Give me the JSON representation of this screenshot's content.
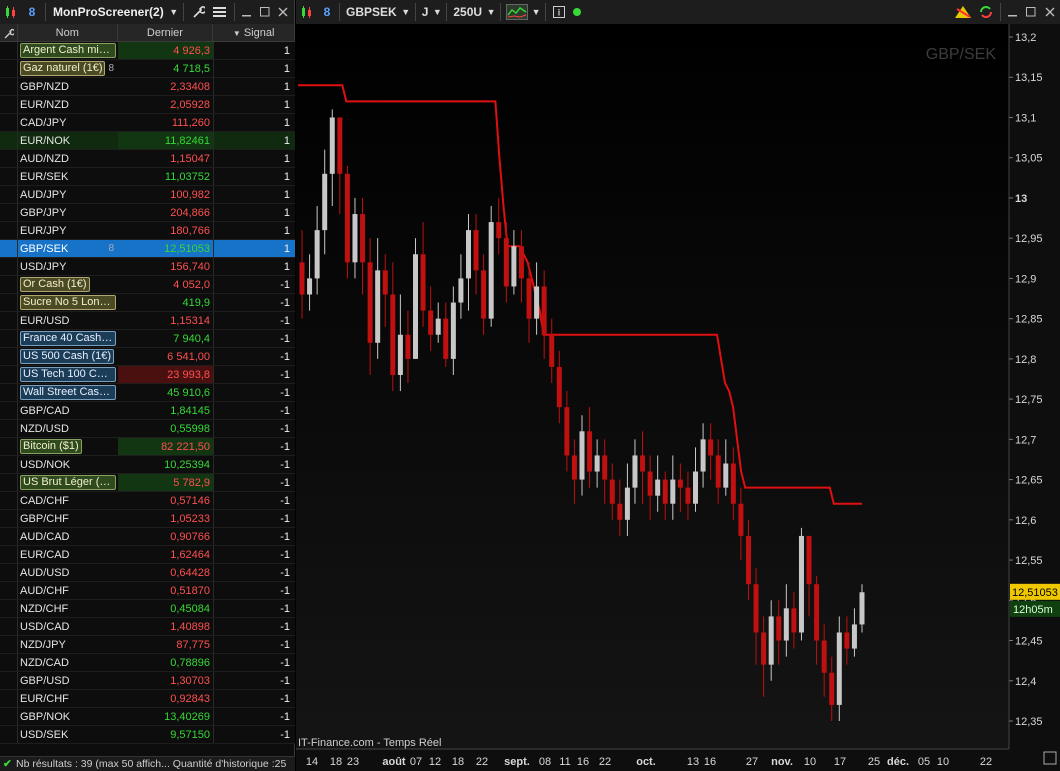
{
  "screener": {
    "title": "MonProScreener(2)",
    "columns": {
      "name": "Nom",
      "last": "Dernier",
      "signal": "Signal"
    },
    "rows": [
      {
        "name": "Argent Cash mini ...",
        "last": "4 926,3",
        "signal": "1",
        "style": "chip-green",
        "color": "#ff5050"
      },
      {
        "name": "Gaz naturel (1€)",
        "last": "4 718,5",
        "signal": "1",
        "style": "chip-olive",
        "color": "#36d936"
      },
      {
        "name": "GBP/NZD",
        "last": "2,33408",
        "signal": "1",
        "style": "",
        "color": "#ff5050"
      },
      {
        "name": "EUR/NZD",
        "last": "2,05928",
        "signal": "1",
        "style": "",
        "color": "#ff5050"
      },
      {
        "name": "CAD/JPY",
        "last": "111,260",
        "signal": "1",
        "style": "",
        "color": "#ff5050"
      },
      {
        "name": "EUR/NOK",
        "last": "11,82461",
        "signal": "1",
        "style": "green",
        "color": "#36d936"
      },
      {
        "name": "AUD/NZD",
        "last": "1,15047",
        "signal": "1",
        "style": "",
        "color": "#ff5050"
      },
      {
        "name": "EUR/SEK",
        "last": "11,03752",
        "signal": "1",
        "style": "",
        "color": "#36d936"
      },
      {
        "name": "AUD/JPY",
        "last": "100,982",
        "signal": "1",
        "style": "",
        "color": "#ff5050"
      },
      {
        "name": "GBP/JPY",
        "last": "204,866",
        "signal": "1",
        "style": "",
        "color": "#ff5050"
      },
      {
        "name": "EUR/JPY",
        "last": "180,766",
        "signal": "1",
        "style": "",
        "color": "#ff5050"
      },
      {
        "name": "GBP/SEK",
        "last": "12,51053",
        "signal": "1",
        "style": "sel",
        "color": "#36d936"
      },
      {
        "name": "USD/JPY",
        "last": "156,740",
        "signal": "1",
        "style": "",
        "color": "#ff5050"
      },
      {
        "name": "Or Cash (1€)",
        "last": "4 052,0",
        "signal": "-1",
        "style": "chip-olive",
        "color": "#ff5050"
      },
      {
        "name": "Sucre No 5 Londr...",
        "last": "419,9",
        "signal": "-1",
        "style": "chip-olive",
        "color": "#36d936"
      },
      {
        "name": "EUR/USD",
        "last": "1,15314",
        "signal": "-1",
        "style": "",
        "color": "#ff5050"
      },
      {
        "name": "France 40 Cash (...",
        "last": "7 940,4",
        "signal": "-1",
        "style": "chip-blue",
        "color": "#36d936"
      },
      {
        "name": "US 500 Cash (1€)",
        "last": "6 541,00",
        "signal": "-1",
        "style": "chip-blue",
        "color": "#ff5050"
      },
      {
        "name": "US Tech 100 Cas...",
        "last": "23 993,8",
        "signal": "-1",
        "style": "chip-blue-red",
        "color": "#ff5050"
      },
      {
        "name": "Wall Street Cash ...",
        "last": "45 910,6",
        "signal": "-1",
        "style": "chip-blue",
        "color": "#36d936"
      },
      {
        "name": "GBP/CAD",
        "last": "1,84145",
        "signal": "-1",
        "style": "",
        "color": "#36d936"
      },
      {
        "name": "NZD/USD",
        "last": "0,55998",
        "signal": "-1",
        "style": "",
        "color": "#36d936"
      },
      {
        "name": "Bitcoin ($1)",
        "last": "82 221,50",
        "signal": "-1",
        "style": "chip-green",
        "color": "#ff5050"
      },
      {
        "name": "USD/NOK",
        "last": "10,25394",
        "signal": "-1",
        "style": "",
        "color": "#36d936"
      },
      {
        "name": "US Brut Léger (1$)",
        "last": "5 782,9",
        "signal": "-1",
        "style": "chip-green",
        "color": "#ff5050"
      },
      {
        "name": "CAD/CHF",
        "last": "0,57146",
        "signal": "-1",
        "style": "",
        "color": "#ff5050"
      },
      {
        "name": "GBP/CHF",
        "last": "1,05233",
        "signal": "-1",
        "style": "",
        "color": "#ff5050"
      },
      {
        "name": "AUD/CAD",
        "last": "0,90766",
        "signal": "-1",
        "style": "",
        "color": "#ff5050"
      },
      {
        "name": "EUR/CAD",
        "last": "1,62464",
        "signal": "-1",
        "style": "",
        "color": "#ff5050"
      },
      {
        "name": "AUD/USD",
        "last": "0,64428",
        "signal": "-1",
        "style": "",
        "color": "#ff5050"
      },
      {
        "name": "AUD/CHF",
        "last": "0,51870",
        "signal": "-1",
        "style": "",
        "color": "#ff5050"
      },
      {
        "name": "NZD/CHF",
        "last": "0,45084",
        "signal": "-1",
        "style": "",
        "color": "#36d936"
      },
      {
        "name": "USD/CAD",
        "last": "1,40898",
        "signal": "-1",
        "style": "",
        "color": "#ff5050"
      },
      {
        "name": "NZD/JPY",
        "last": "87,775",
        "signal": "-1",
        "style": "",
        "color": "#ff5050"
      },
      {
        "name": "NZD/CAD",
        "last": "0,78896",
        "signal": "-1",
        "style": "",
        "color": "#36d936"
      },
      {
        "name": "GBP/USD",
        "last": "1,30703",
        "signal": "-1",
        "style": "",
        "color": "#ff5050"
      },
      {
        "name": "EUR/CHF",
        "last": "0,92843",
        "signal": "-1",
        "style": "",
        "color": "#ff5050"
      },
      {
        "name": "GBP/NOK",
        "last": "13,40269",
        "signal": "-1",
        "style": "",
        "color": "#36d936"
      },
      {
        "name": "USD/SEK",
        "last": "9,57150",
        "signal": "-1",
        "style": "",
        "color": "#36d936"
      }
    ],
    "status": "Nb résultats : 39 (max 50 affich...  Quantité d'historique :25"
  },
  "chart_toolbar": {
    "symbol": "GBPSEK",
    "period": "J",
    "units": "250U"
  },
  "chart": {
    "watermark": "GBP/SEK",
    "source": "IT-Finance.com - Temps Réel",
    "price_tag": "12,51053",
    "time_tag": "12h05m",
    "y_ticks": [
      "13,2",
      "13,15",
      "13,1",
      "13,05",
      "13",
      "12,95",
      "12,9",
      "12,85",
      "12,8",
      "12,75",
      "12,7",
      "12,65",
      "12,6",
      "12,55",
      "12,5",
      "12,45",
      "12,4",
      "12,35"
    ],
    "x_ticks": [
      "14",
      "18",
      "23",
      "août",
      "07",
      "12",
      "18",
      "22",
      "sept.",
      "08",
      "11",
      "16",
      "22",
      "oct.",
      "13",
      "16",
      "27",
      "nov.",
      "10",
      "17",
      "25",
      "déc.",
      "05",
      "10",
      "22"
    ]
  },
  "chart_data": {
    "type": "candlestick",
    "ylim": [
      12.32,
      13.22
    ],
    "trailing_stop": [
      13.14,
      13.14,
      13.14,
      13.14,
      13.14,
      13.14,
      13.14,
      13.14,
      13.14,
      13.14,
      13.14,
      13.14,
      13.12,
      13.12,
      13.12,
      13.12,
      13.12,
      13.12,
      13.12,
      13.12,
      13.12,
      13.12,
      13.12,
      13.12,
      13.12,
      13.12,
      13.12,
      13.12,
      13.12,
      13.12,
      13.12,
      13.12,
      13.12,
      13.12,
      13.12,
      13.12,
      13.12,
      13.12,
      13.12,
      13.12,
      13.12,
      13.12,
      13.12,
      13.12,
      13.12,
      13.12,
      13.12,
      13.12,
      13.12,
      13.12,
      13.05,
      12.99,
      12.94,
      12.94,
      12.94,
      12.94,
      12.93,
      12.92,
      12.9,
      12.88,
      12.86,
      12.83,
      12.83,
      12.83,
      12.83,
      12.83,
      12.83,
      12.83,
      12.83,
      12.83,
      12.83,
      12.83,
      12.83,
      12.83,
      12.83,
      12.83,
      12.83,
      12.83,
      12.83,
      12.83,
      12.83,
      12.83,
      12.83,
      12.83,
      12.83,
      12.83,
      12.83,
      12.83,
      12.83,
      12.83,
      12.83,
      12.83,
      12.83,
      12.83,
      12.83,
      12.83,
      12.83,
      12.83,
      12.83,
      12.83,
      12.83,
      12.83,
      12.83,
      12.83,
      12.83,
      12.8,
      12.77,
      12.76,
      12.74,
      12.7,
      12.66,
      12.64,
      12.64,
      12.64,
      12.64,
      12.64,
      12.64,
      12.64,
      12.64,
      12.64,
      12.64,
      12.64,
      12.64,
      12.64,
      12.64,
      12.64,
      12.64,
      12.64,
      12.64,
      12.64,
      12.64,
      12.64,
      12.64,
      12.62,
      12.62,
      12.62,
      12.62,
      12.62,
      12.62,
      12.62,
      12.62
    ],
    "candles": [
      [
        12.92,
        12.88,
        12.96,
        12.85
      ],
      [
        12.88,
        12.9,
        12.93,
        12.86
      ],
      [
        12.9,
        12.96,
        12.99,
        12.88
      ],
      [
        12.96,
        13.03,
        13.06,
        12.93
      ],
      [
        13.03,
        13.1,
        13.11,
        12.99
      ],
      [
        13.1,
        13.03,
        13.1,
        12.98
      ],
      [
        13.03,
        12.92,
        13.04,
        12.9
      ],
      [
        12.92,
        12.98,
        13.0,
        12.9
      ],
      [
        12.98,
        12.92,
        13.0,
        12.88
      ],
      [
        12.92,
        12.82,
        12.95,
        12.78
      ],
      [
        12.82,
        12.91,
        12.95,
        12.8
      ],
      [
        12.91,
        12.88,
        12.93,
        12.84
      ],
      [
        12.88,
        12.78,
        12.92,
        12.76
      ],
      [
        12.78,
        12.83,
        12.88,
        12.76
      ],
      [
        12.83,
        12.8,
        12.86,
        12.77
      ],
      [
        12.8,
        12.93,
        12.95,
        12.8
      ],
      [
        12.93,
        12.86,
        12.97,
        12.84
      ],
      [
        12.86,
        12.83,
        12.89,
        12.81
      ],
      [
        12.83,
        12.85,
        12.87,
        12.82
      ],
      [
        12.85,
        12.8,
        12.87,
        12.79
      ],
      [
        12.8,
        12.87,
        12.89,
        12.78
      ],
      [
        12.87,
        12.9,
        12.93,
        12.85
      ],
      [
        12.9,
        12.96,
        12.98,
        12.86
      ],
      [
        12.96,
        12.91,
        12.98,
        12.88
      ],
      [
        12.91,
        12.85,
        12.93,
        12.83
      ],
      [
        12.85,
        12.97,
        12.99,
        12.84
      ],
      [
        12.97,
        12.95,
        13.0,
        12.93
      ],
      [
        12.95,
        12.89,
        12.97,
        12.87
      ],
      [
        12.89,
        12.94,
        12.96,
        12.88
      ],
      [
        12.94,
        12.9,
        12.96,
        12.87
      ],
      [
        12.9,
        12.85,
        12.92,
        12.82
      ],
      [
        12.85,
        12.89,
        12.92,
        12.83
      ],
      [
        12.89,
        12.83,
        12.91,
        12.8
      ],
      [
        12.83,
        12.79,
        12.85,
        12.77
      ],
      [
        12.79,
        12.74,
        12.81,
        12.72
      ],
      [
        12.74,
        12.68,
        12.76,
        12.66
      ],
      [
        12.68,
        12.65,
        12.7,
        12.62
      ],
      [
        12.65,
        12.71,
        12.73,
        12.63
      ],
      [
        12.71,
        12.66,
        12.74,
        12.64
      ],
      [
        12.66,
        12.68,
        12.7,
        12.64
      ],
      [
        12.68,
        12.65,
        12.7,
        12.62
      ],
      [
        12.65,
        12.62,
        12.67,
        12.6
      ],
      [
        12.62,
        12.6,
        12.65,
        12.58
      ],
      [
        12.6,
        12.64,
        12.67,
        12.58
      ],
      [
        12.64,
        12.68,
        12.7,
        12.62
      ],
      [
        12.68,
        12.66,
        12.71,
        12.62
      ],
      [
        12.66,
        12.63,
        12.68,
        12.6
      ],
      [
        12.63,
        12.65,
        12.68,
        12.61
      ],
      [
        12.65,
        12.62,
        12.66,
        12.6
      ],
      [
        12.62,
        12.65,
        12.68,
        12.6
      ],
      [
        12.65,
        12.64,
        12.67,
        12.61
      ],
      [
        12.64,
        12.62,
        12.66,
        12.6
      ],
      [
        12.62,
        12.66,
        12.69,
        12.61
      ],
      [
        12.66,
        12.7,
        12.72,
        12.64
      ],
      [
        12.7,
        12.68,
        12.72,
        12.65
      ],
      [
        12.68,
        12.64,
        12.7,
        12.62
      ],
      [
        12.64,
        12.67,
        12.7,
        12.63
      ],
      [
        12.67,
        12.62,
        12.69,
        12.6
      ],
      [
        12.62,
        12.58,
        12.64,
        12.55
      ],
      [
        12.58,
        12.52,
        12.6,
        12.5
      ],
      [
        12.52,
        12.46,
        12.54,
        12.42
      ],
      [
        12.46,
        12.42,
        12.48,
        12.38
      ],
      [
        12.42,
        12.48,
        12.5,
        12.4
      ],
      [
        12.48,
        12.45,
        12.5,
        12.42
      ],
      [
        12.45,
        12.49,
        12.52,
        12.43
      ],
      [
        12.49,
        12.46,
        12.51,
        12.44
      ],
      [
        12.46,
        12.58,
        12.59,
        12.45
      ],
      [
        12.58,
        12.52,
        12.58,
        12.48
      ],
      [
        12.52,
        12.45,
        12.53,
        12.42
      ],
      [
        12.45,
        12.41,
        12.47,
        12.38
      ],
      [
        12.41,
        12.37,
        12.43,
        12.35
      ],
      [
        12.37,
        12.46,
        12.48,
        12.35
      ],
      [
        12.46,
        12.44,
        12.48,
        12.42
      ],
      [
        12.44,
        12.47,
        12.49,
        12.43
      ],
      [
        12.47,
        12.51,
        12.52,
        12.46
      ]
    ]
  }
}
